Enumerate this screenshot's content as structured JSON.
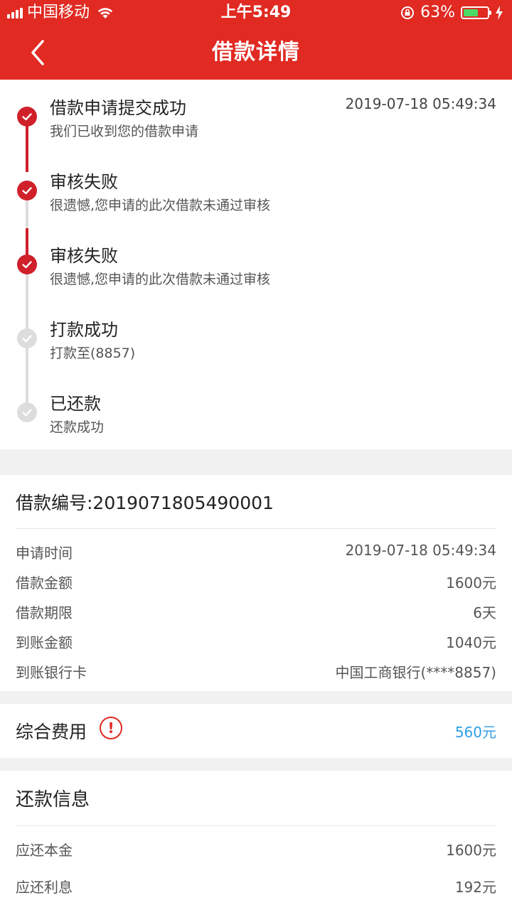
{
  "status_bar": {
    "carrier": "中国移动",
    "time": "上午5:49",
    "battery_text": "63%",
    "battery_level": 0.63
  },
  "nav": {
    "title": "借款详情",
    "back_icon": "chevron-left-icon"
  },
  "colors": {
    "brand": "#e02a22",
    "step_done": "#d0202a",
    "step_pending": "#dddddd",
    "link_blue": "#2e9fe6"
  },
  "timeline": {
    "steps": [
      {
        "title": "借款申请提交成功",
        "subtitle": "我们已收到您的借款申请",
        "time": "2019-07-18 05:49:34",
        "done": true
      },
      {
        "title": "审核失败",
        "subtitle": "很遗憾,您申请的此次借款未通过审核",
        "done": true
      },
      {
        "title": "审核失败",
        "subtitle": "很遗憾,您申请的此次借款未通过审核",
        "done": true
      },
      {
        "title": "打款成功",
        "subtitle": "打款至(8857)",
        "done": false
      },
      {
        "title": "已还款",
        "subtitle": "还款成功",
        "done": false
      }
    ]
  },
  "loan": {
    "number_label": "借款编号:2019071805490001",
    "rows": [
      {
        "label": "申请时间",
        "value": "2019-07-18 05:49:34"
      },
      {
        "label": "借款金额",
        "value": "1600元"
      },
      {
        "label": "借款期限",
        "value": "6天"
      },
      {
        "label": "到账金额",
        "value": "1040元"
      },
      {
        "label": "到账银行卡",
        "value": "中国工商银行(****8857)"
      }
    ]
  },
  "fee": {
    "label": "综合费用",
    "icon_text": "!",
    "value": "560元"
  },
  "repay": {
    "title": "还款信息",
    "rows": [
      {
        "label": "应还本金",
        "value": "1600元"
      },
      {
        "label": "应还利息",
        "value": "192元"
      }
    ]
  }
}
